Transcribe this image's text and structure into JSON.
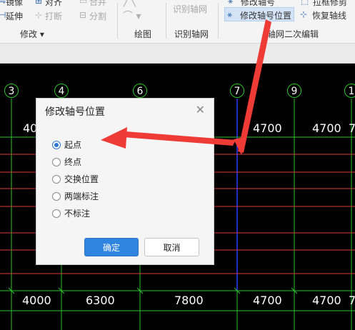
{
  "ribbon": {
    "modify_group": {
      "mirror": "镜像",
      "align": "对齐",
      "merge": "合并",
      "extend": "延伸",
      "break": "打断",
      "split": "分割",
      "label": "修改"
    },
    "draw_group": {
      "label": "绘图"
    },
    "identify_group": {
      "identify_axis": "识别轴网",
      "label": "识别轴网"
    },
    "axis_edit_group": {
      "modify_axis_no": "修改轴号",
      "stretch_modify": "拉框修剪",
      "modify_axis_pos": "修改轴号位置",
      "restore_axis": "恢复轴线",
      "label": "轴网二次编辑"
    }
  },
  "canvas": {
    "axis_numbers": [
      "3",
      "4",
      "6",
      "7",
      "9",
      "1"
    ],
    "top_dims": [
      "40",
      "4700",
      "4700",
      "7"
    ],
    "bottom_dims": [
      "4000",
      "6300",
      "7800",
      "4700",
      "4700",
      "7"
    ]
  },
  "dialog": {
    "title": "修改轴号位置",
    "options": [
      "起点",
      "终点",
      "交换位置",
      "两端标注",
      "不标注"
    ],
    "selected": "起点",
    "ok": "确定",
    "cancel": "取消"
  },
  "colors": {
    "grid_green": "#2dc42d",
    "grid_red": "#e23a3a",
    "axis_blue": "#2f3bff",
    "annotation_arrow": "#ef3b36",
    "primary_button": "#2f84e0"
  },
  "icons": [
    "mirror-icon",
    "align-icon",
    "merge-icon",
    "extend-icon",
    "break-icon",
    "split-icon",
    "arc-icon",
    "modify-axis-no-icon",
    "stretch-icon",
    "modify-axis-pos-icon",
    "restore-axis-icon",
    "close-icon"
  ]
}
